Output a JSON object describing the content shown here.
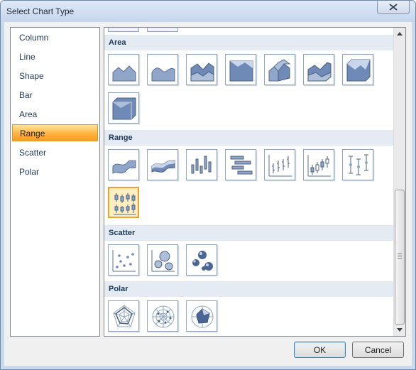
{
  "window": {
    "title": "Select Chart Type"
  },
  "categories": [
    {
      "label": "Column",
      "selected": false
    },
    {
      "label": "Line",
      "selected": false
    },
    {
      "label": "Shape",
      "selected": false
    },
    {
      "label": "Bar",
      "selected": false
    },
    {
      "label": "Area",
      "selected": false
    },
    {
      "label": "Range",
      "selected": true
    },
    {
      "label": "Scatter",
      "selected": false
    },
    {
      "label": "Polar",
      "selected": false
    }
  ],
  "sections": [
    {
      "header": "Area",
      "tiles": [
        "area-icon",
        "smooth-area-icon",
        "stacked-area-icon",
        "full-stacked-area-icon",
        "area-3d-icon",
        "stacked-area-3d-icon",
        "full-stacked-area-3d-icon",
        "area-3d-box-icon"
      ]
    },
    {
      "header": "Range",
      "tiles": [
        "range-area-icon",
        "range-area-3d-icon",
        "range-bar-icon",
        "gantt-icon",
        "stock-icon",
        "candlestick-icon",
        "error-bar-icon",
        "box-plot-icon"
      ],
      "selected_index": 7
    },
    {
      "header": "Scatter",
      "tiles": [
        "point-icon",
        "bubble-icon",
        "bubble-3d-icon"
      ]
    },
    {
      "header": "Polar",
      "tiles": [
        "radar-line-icon",
        "radar-point-icon",
        "radar-area-icon"
      ]
    }
  ],
  "buttons": {
    "ok": "OK",
    "cancel": "Cancel"
  },
  "colors": {
    "selection": "#ffb03a",
    "section_header": "#e4ebf3",
    "tile_border": "#8ea6c2",
    "chart_fill": "#6f8ab6"
  }
}
